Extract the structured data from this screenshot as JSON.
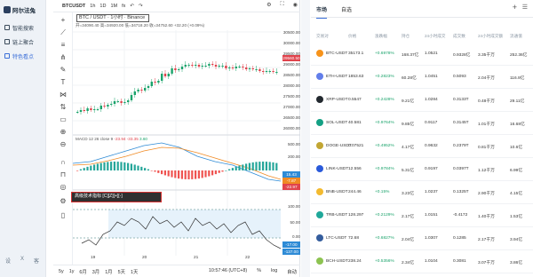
{
  "nav": {
    "logo": "阿尔法兔",
    "items": [
      {
        "label": "智能搜索",
        "active": false
      },
      {
        "label": "链上聚合",
        "active": false
      },
      {
        "label": "特色看点",
        "active": true
      }
    ],
    "footer": [
      "设",
      "X",
      "客"
    ]
  },
  "chart": {
    "topbar": {
      "symbol": "BTCUSDT",
      "intervals": [
        "1h",
        "1D",
        "1M"
      ],
      "indicator_label": "fx",
      "undo": "↶",
      "redo": "↷",
      "icons": [
        "gear-icon",
        "fullscreen-icon",
        "camera-icon"
      ]
    },
    "symbol_title": "BTC / USDT · 1小时 · Binance",
    "ohlc": "开=34090.40 高=34920.00 低=34718.20 收=34752.60 +32.20 (+0.09%)",
    "macd_label": "MACD 12 26 close 9",
    "macd_values": [
      "-23.94",
      "-33.35",
      "3.60"
    ],
    "rsi_tooltip": "高级技术指标 [C][Z][+][-]",
    "price_tag": "29560.50",
    "price_axis": [
      "30500.00",
      "30000.00",
      "29500.00",
      "29000.00",
      "28500.00",
      "28000.00",
      "27500.00",
      "27000.00",
      "26500.00",
      "26000.00"
    ],
    "macd_axis": [
      "500.00",
      "200.00",
      "0.00",
      "-200.00"
    ],
    "macd_tags": [
      "15.43",
      "-7.87",
      "-22.97"
    ],
    "rsi_axis": [
      "100.00",
      "50.00",
      "0.00"
    ],
    "rsi_tags": [
      "-17.00",
      "-137.00"
    ],
    "x_labels": [
      "19",
      "20",
      "21",
      "22"
    ],
    "bottombar": {
      "ranges": [
        "5y",
        "1y",
        "1月",
        "6月",
        "3月",
        "1月",
        "5天",
        "1天"
      ],
      "time": "10:57:46 (UTC+8)",
      "right": [
        "%",
        "log",
        "自动"
      ]
    }
  },
  "market": {
    "tabs": [
      "市场",
      "自选"
    ],
    "add": "+",
    "menu": "☰",
    "headers": [
      "交易对",
      "价格",
      "涨跌幅",
      "持仓",
      "24小时成交",
      "成交数",
      "24小时成交额",
      "流通值"
    ],
    "rows": [
      {
        "pair": "BTC-USDT",
        "price": "35173.1",
        "change": "+0.6978%",
        "oi": "168.37亿",
        "vol": "1.0521",
        "trades": "0.9328亿",
        "turnover": "3.35千万",
        "cap": "252.36亿",
        "color": "#f7931a"
      },
      {
        "pair": "ETH-USDT",
        "price": "1853.63",
        "change": "+0.2823%",
        "oi": "60.28亿",
        "vol": "1.0451",
        "trades": "0.5093",
        "turnover": "2.04千万",
        "cap": "116.9亿",
        "color": "#627eea"
      },
      {
        "pair": "XRP-USDT",
        "price": "0.5547",
        "change": "+0.2428%",
        "oi": "9.21亿",
        "vol": "1.0284",
        "trades": "0.3133T",
        "turnover": "0.48千万",
        "cap": "29.11亿",
        "color": "#23292f"
      },
      {
        "pair": "SOL-USDT",
        "price": "40.581",
        "change": "+0.9764%",
        "oi": "9.85亿",
        "vol": "0.9117",
        "trades": "0.3145T",
        "turnover": "1.01千万",
        "cap": "16.68亿",
        "color": "#14a084"
      },
      {
        "pair": "DOGE-USDT",
        "price": "0.07521",
        "change": "+0.4952%",
        "oi": "4.17亿",
        "vol": "0.9632",
        "trades": "0.2379T",
        "turnover": "0.81千万",
        "cap": "10.6亿",
        "color": "#c2a633"
      },
      {
        "pair": "LINK-USDT",
        "price": "12.556",
        "change": "+0.9784%",
        "oi": "5.31亿",
        "vol": "0.9197",
        "trades": "0.0397T",
        "turnover": "1.12千万",
        "cap": "6.99亿",
        "color": "#2a5ada"
      },
      {
        "pair": "BNB-USDT",
        "price": "244.46",
        "change": "+0.15%",
        "oi": "3.23亿",
        "vol": "1.0237",
        "trades": "0.1325T",
        "turnover": "2.90千万",
        "cap": "4.15亿",
        "color": "#f3ba2f"
      },
      {
        "pair": "TRB-USDT",
        "price": "128.297",
        "change": "+0.2129%",
        "oi": "2.17亿",
        "vol": "1.0151",
        "trades": "-0.4172",
        "turnover": "1.40千万",
        "cap": "1.53亿",
        "color": "#20a89a"
      },
      {
        "pair": "LTC-USDT",
        "price": "72.68",
        "change": "+0.6827%",
        "oi": "2.04亿",
        "vol": "1.0307",
        "trades": "0.1285",
        "turnover": "2.17千万",
        "cap": "3.94亿",
        "color": "#345d9d"
      },
      {
        "pair": "BCH-USDT",
        "price": "238.24",
        "change": "+0.5356%",
        "oi": "2.34亿",
        "vol": "1.0104",
        "trades": "0.3081",
        "turnover": "3.07千万",
        "cap": "3.86亿",
        "color": "#8dc351"
      }
    ]
  }
}
